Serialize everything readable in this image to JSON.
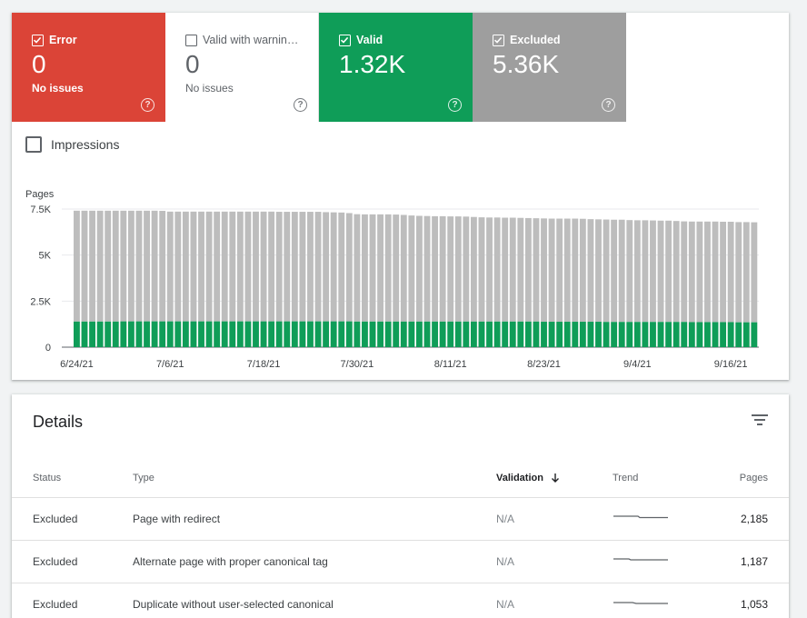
{
  "tiles": [
    {
      "label": "Error",
      "value": "0",
      "sub": "No issues",
      "checked": true
    },
    {
      "label": "Valid with warnin…",
      "value": "0",
      "sub": "No issues",
      "checked": false
    },
    {
      "label": "Valid",
      "value": "1.32K",
      "sub": "",
      "checked": true
    },
    {
      "label": "Excluded",
      "value": "5.36K",
      "sub": "",
      "checked": true
    }
  ],
  "help_glyph": "?",
  "impressions_label": "Impressions",
  "colors": {
    "error": "#db4437",
    "valid": "#0f9d58",
    "excluded": "#9e9e9e",
    "bar_gray": "#bdbdbd",
    "bar_green": "#0f9d58"
  },
  "chart_data": {
    "type": "bar",
    "stacked": true,
    "ylabel": "Pages",
    "ylim": [
      0,
      7500
    ],
    "yticks": [
      "0",
      "2.5K",
      "5K",
      "7.5K"
    ],
    "ytick_values": [
      0,
      2500,
      5000,
      7500
    ],
    "xtick_labels": [
      "6/24/21",
      "7/6/21",
      "7/18/21",
      "7/30/21",
      "8/11/21",
      "8/23/21",
      "9/4/21",
      "9/16/21"
    ],
    "xtick_indices": [
      0,
      12,
      24,
      36,
      48,
      60,
      72,
      84
    ],
    "grid": true,
    "series": [
      {
        "name": "Valid",
        "values": [
          1390,
          1390,
          1390,
          1390,
          1390,
          1390,
          1400,
          1400,
          1400,
          1400,
          1400,
          1400,
          1400,
          1400,
          1400,
          1400,
          1400,
          1400,
          1400,
          1400,
          1400,
          1400,
          1400,
          1400,
          1400,
          1400,
          1400,
          1400,
          1400,
          1400,
          1400,
          1400,
          1400,
          1400,
          1400,
          1400,
          1390,
          1390,
          1390,
          1390,
          1390,
          1390,
          1390,
          1390,
          1390,
          1390,
          1390,
          1390,
          1390,
          1390,
          1390,
          1390,
          1390,
          1390,
          1390,
          1390,
          1390,
          1390,
          1390,
          1390,
          1380,
          1380,
          1380,
          1380,
          1380,
          1380,
          1380,
          1380,
          1370,
          1370,
          1370,
          1370,
          1370,
          1370,
          1370,
          1370,
          1370,
          1370,
          1370,
          1360,
          1360,
          1360,
          1360,
          1360,
          1360,
          1350,
          1350,
          1350
        ]
      },
      {
        "name": "Excluded",
        "values": [
          6020,
          6020,
          6020,
          6020,
          6020,
          6020,
          6010,
          6010,
          6010,
          6010,
          6010,
          6000,
          5960,
          5960,
          5960,
          5960,
          5960,
          5960,
          5960,
          5960,
          5960,
          5960,
          5960,
          5960,
          5960,
          5960,
          5950,
          5950,
          5950,
          5950,
          5950,
          5950,
          5930,
          5920,
          5910,
          5880,
          5830,
          5820,
          5820,
          5820,
          5820,
          5810,
          5790,
          5760,
          5740,
          5730,
          5720,
          5720,
          5710,
          5710,
          5700,
          5680,
          5660,
          5650,
          5650,
          5640,
          5640,
          5630,
          5620,
          5610,
          5610,
          5600,
          5600,
          5600,
          5600,
          5590,
          5570,
          5560,
          5560,
          5550,
          5550,
          5530,
          5520,
          5520,
          5510,
          5500,
          5500,
          5480,
          5460,
          5460,
          5460,
          5460,
          5460,
          5450,
          5450,
          5440,
          5440,
          5430
        ]
      }
    ]
  },
  "details": {
    "title": "Details",
    "columns": {
      "status": "Status",
      "type": "Type",
      "validation": "Validation",
      "trend": "Trend",
      "pages": "Pages"
    },
    "rows": [
      {
        "status": "Excluded",
        "type": "Page with redirect",
        "validation": "N/A",
        "pages": "2,185"
      },
      {
        "status": "Excluded",
        "type": "Alternate page with proper canonical tag",
        "validation": "N/A",
        "pages": "1,187"
      },
      {
        "status": "Excluded",
        "type": "Duplicate without user-selected canonical",
        "validation": "N/A",
        "pages": "1,053"
      }
    ]
  }
}
